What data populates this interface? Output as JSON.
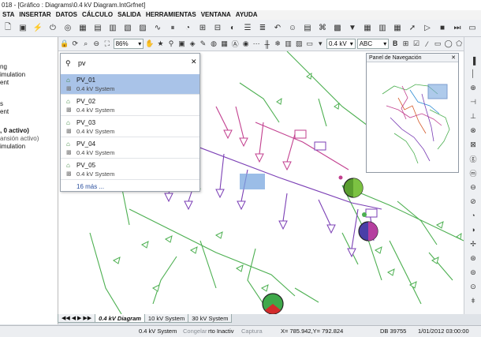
{
  "title": "018 - [Gráfico : Diagrams\\0.4 kV Diagram.IntGrfnet]",
  "menu": [
    "STA",
    "INSERTAR",
    "DATOS",
    "CÁLCULO",
    "SALIDA",
    "HERRAMIENTAS",
    "VENTANA",
    "AYUDA"
  ],
  "left_panel": {
    "items": [
      "ng",
      "imulation",
      "ent",
      "s",
      "ent",
      ", 0 activo)",
      "ansión activo)",
      "imulation"
    ]
  },
  "toolbar2": {
    "zoom_value": "86%",
    "voltage_value": "0.4 kV",
    "text_value": "ABC"
  },
  "search": {
    "query": "pv",
    "results": [
      {
        "name": "PV_01",
        "system": "0.4 kV System"
      },
      {
        "name": "PV_02",
        "system": "0.4 kV System"
      },
      {
        "name": "PV_03",
        "system": "0.4 kV System"
      },
      {
        "name": "PV_04",
        "system": "0.4 kV System"
      },
      {
        "name": "PV_05",
        "system": "0.4 kV System"
      }
    ],
    "more": "16 más ..."
  },
  "nav_panel": {
    "title": "Panel de Navegación"
  },
  "tabs": [
    "0.4 kV Diagram",
    "10 kV System",
    "30 kV System"
  ],
  "status": {
    "system": "0.4 kV System",
    "congelar": "Congelar",
    "rto": "rto Inactiv",
    "captura": "Captura",
    "coords": "X=    785.942,Y=     792.824",
    "db": "DB 39755",
    "datetime": "1/01/2012 03:00:00"
  },
  "colors": {
    "green_line": "#4caf50",
    "purple_line": "#7b3fb5",
    "pink_line": "#c2408f",
    "selection": "#a9c3e8",
    "highlight_box": "#7aa7df"
  }
}
